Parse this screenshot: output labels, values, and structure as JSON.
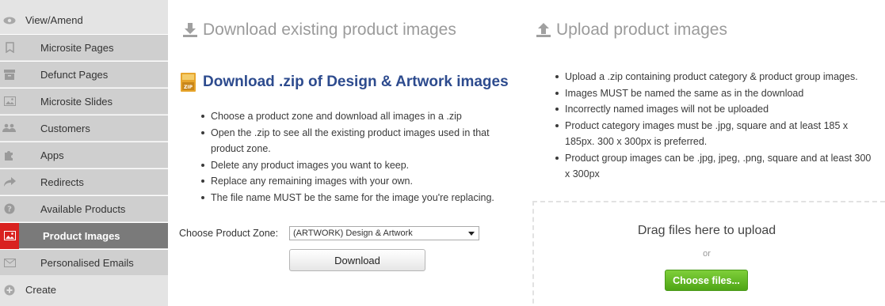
{
  "sidebar": {
    "items": [
      {
        "label": "View/Amend",
        "icon": "eye-icon"
      },
      {
        "label": "Microsite Pages",
        "icon": "bookmark-icon"
      },
      {
        "label": "Defunct Pages",
        "icon": "archive-icon"
      },
      {
        "label": "Microsite Slides",
        "icon": "image-icon"
      },
      {
        "label": "Customers",
        "icon": "users-icon"
      },
      {
        "label": "Apps",
        "icon": "puzzle-icon"
      },
      {
        "label": "Redirects",
        "icon": "share-arrow-icon"
      },
      {
        "label": "Available Products",
        "icon": "question-icon"
      },
      {
        "label": "Product Images",
        "icon": "picture-icon"
      },
      {
        "label": "Personalised Emails",
        "icon": "envelope-icon"
      },
      {
        "label": "Create",
        "icon": "plus-circle-icon"
      }
    ]
  },
  "download": {
    "heading": "Download existing product images",
    "zip_title": "Download .zip of Design & Artwork images",
    "bullets": [
      "Choose a product zone and download all images in a .zip",
      "Open the .zip to see all the existing product images used in that product zone.",
      "Delete any product images you want to keep.",
      "Replace any remaining images with your own.",
      "The file name MUST be the same for the image you're replacing."
    ],
    "zone_label": "Choose Product Zone:",
    "zone_value": "(ARTWORK)  Design & Artwork",
    "button": "Download"
  },
  "upload": {
    "heading": "Upload product images",
    "bullets": [
      "Upload a .zip containing product category & product group images.",
      "Images MUST be named the same as in the download",
      "Incorrectly named images will not be uploaded",
      "Product category images must be .jpg, square and at least 185 x 185px. 300 x 300px is preferred.",
      "Product group images can be .jpg, jpeg, .png, square and at least 300 x 300px"
    ],
    "drop_title": "Drag files here to upload",
    "or": "or",
    "button": "Choose files..."
  },
  "colors": {
    "active_accent": "#d9211f",
    "zip_title": "#2d4b8e",
    "choose_button": "#5cb31f"
  }
}
